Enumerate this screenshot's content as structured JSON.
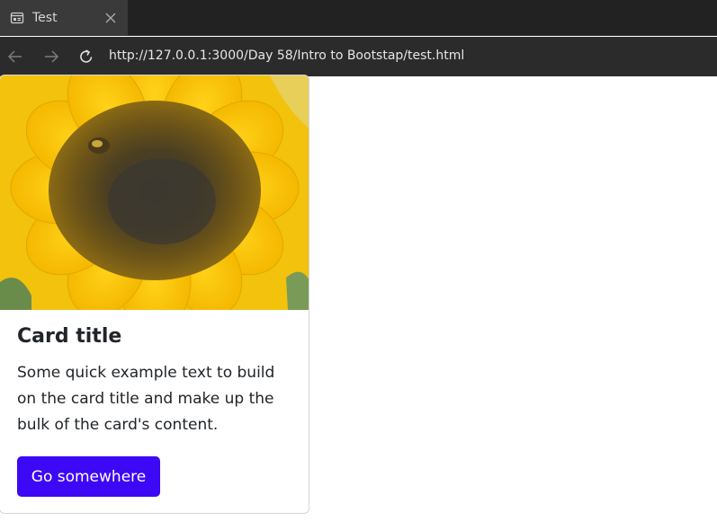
{
  "browser": {
    "tab": {
      "title": "Test",
      "icon": "page-icon",
      "close_icon": "close-icon"
    },
    "nav": {
      "back_icon": "arrow-left-icon",
      "forward_icon": "arrow-right-icon",
      "reload_icon": "reload-icon",
      "url": "http://127.0.0.1:3000/Day 58/Intro to Bootstap/test.html"
    }
  },
  "card": {
    "image": "sunflower-image",
    "title": "Card title",
    "text": "Some quick example text to build on the card title and make up the bulk of the card's content.",
    "button_label": "Go somewhere",
    "button_color": "#3d08f5"
  }
}
